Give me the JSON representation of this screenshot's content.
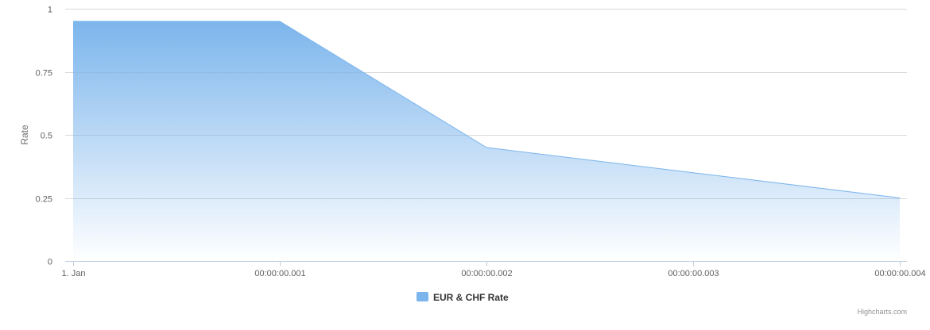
{
  "chart_data": {
    "type": "area",
    "title": "",
    "xlabel": "",
    "ylabel": "Rate",
    "x_tick_labels": [
      "1. Jan",
      "00:00:00.001",
      "00:00:00.002",
      "00:00:00.003",
      "00:00:00.004"
    ],
    "y_tick_labels": [
      "0",
      "0.25",
      "0.5",
      "0.75",
      "1"
    ],
    "x": [
      0,
      1,
      2,
      3,
      4
    ],
    "x_unit": "millisecond",
    "ylim": [
      0,
      1
    ],
    "grid": true,
    "legend_position": "bottom-center",
    "series": [
      {
        "name": "EUR & CHF Rate",
        "values": [
          0.95,
          0.95,
          0.45,
          0.35,
          0.25
        ],
        "color": "#7cb5ec"
      }
    ]
  },
  "credits": "Highcharts.com"
}
